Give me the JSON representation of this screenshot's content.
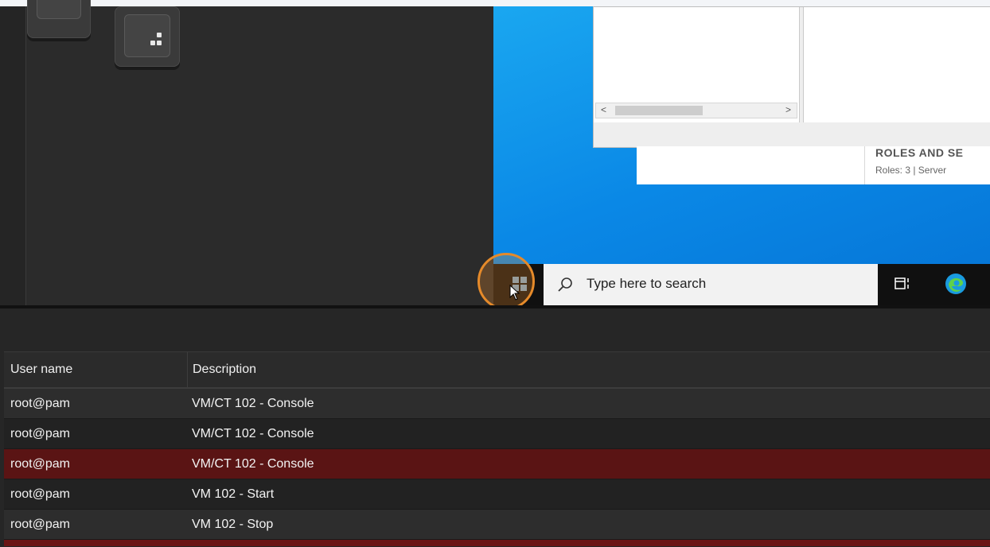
{
  "remote_desktop": {
    "search_placeholder": "Type here to search",
    "server_manager": {
      "roles_title": "ROLES AND SE",
      "roles_summary": "Roles: 3  |  Server"
    },
    "scroll_left": "<",
    "scroll_right": ">"
  },
  "task_log": {
    "columns": [
      "User name",
      "Description"
    ],
    "rows": [
      {
        "user": "root@pam",
        "description": "VM/CT 102 - Console",
        "status": "ok"
      },
      {
        "user": "root@pam",
        "description": "VM/CT 102 - Console",
        "status": "ok"
      },
      {
        "user": "root@pam",
        "description": "VM/CT 102 - Console",
        "status": "error"
      },
      {
        "user": "root@pam",
        "description": "VM 102 - Start",
        "status": "ok"
      },
      {
        "user": "root@pam",
        "description": "VM 102 - Stop",
        "status": "ok"
      }
    ]
  },
  "colors": {
    "desktop_blue": "#0a88e6",
    "error_row": "#5a1414",
    "cursor_highlight": "#e58a2a"
  }
}
